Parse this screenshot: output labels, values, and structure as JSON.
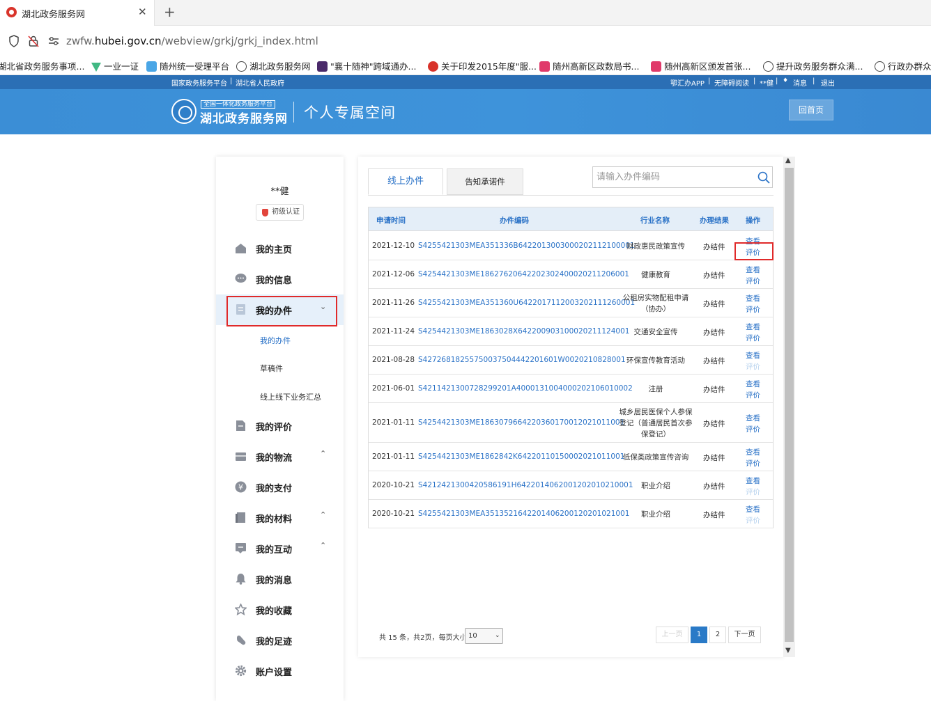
{
  "browser": {
    "tab_title": "湖北政务服务网",
    "tab_close": "✕",
    "new_tab": "+",
    "url_prefix": "zwfw.",
    "url_domain": "hubei.gov.cn",
    "url_path": "/webview/grkj/grkj_index.html",
    "bookmarks": [
      {
        "label": "湖北省政务服务事项...",
        "color": "#ffffff"
      },
      {
        "label": "一业一证",
        "color": "#41b883"
      },
      {
        "label": "随州统一受理平台",
        "color": "#4aa6e6"
      },
      {
        "label": "湖北政务服务网",
        "color": "#ffffff"
      },
      {
        "label": "\"襄十随神\"跨域通办...",
        "color": "#4a2a6a"
      },
      {
        "label": "关于印发2015年度\"服...",
        "color": "#d8322a"
      },
      {
        "label": "随州高新区政数局书...",
        "color": "#e03a6a"
      },
      {
        "label": "随州高新区颁发首张...",
        "color": "#e03a6a"
      },
      {
        "label": "提升政务服务群众满...",
        "color": "#ffffff"
      },
      {
        "label": "行政办群众",
        "color": "#ffffff"
      }
    ]
  },
  "site": {
    "top_left": [
      "国家政务服务平台",
      "|",
      "湖北省人民政府"
    ],
    "top_right": [
      "鄂汇办APP",
      "|",
      "无障碍阅读",
      "|",
      "**健",
      "|",
      "消息",
      "|",
      "退出"
    ],
    "logo_tag": "全国一体化政务服务平台",
    "logo_name": "湖北政务服务网",
    "space_title": "个人专属空间",
    "home_button": "回首页"
  },
  "sidebar": {
    "user_name": "**健",
    "auth_badge": "初级认证",
    "menu": [
      {
        "label": "我的主页",
        "icon": "home-icon",
        "expanded": null
      },
      {
        "label": "我的信息",
        "icon": "chat-icon",
        "expanded": null
      },
      {
        "label": "我的办件",
        "icon": "document-icon",
        "expanded": true
      },
      {
        "label": "我的评价",
        "icon": "evaluation-icon",
        "expanded": null
      },
      {
        "label": "我的物流",
        "icon": "logistics-icon",
        "expanded": false
      },
      {
        "label": "我的支付",
        "icon": "yen-icon",
        "expanded": null
      },
      {
        "label": "我的材料",
        "icon": "materials-icon",
        "expanded": false
      },
      {
        "label": "我的互动",
        "icon": "interaction-icon",
        "expanded": false
      },
      {
        "label": "我的消息",
        "icon": "bell-icon",
        "expanded": null
      },
      {
        "label": "我的收藏",
        "icon": "star-icon",
        "expanded": null
      },
      {
        "label": "我的足迹",
        "icon": "footprint-icon",
        "expanded": null
      },
      {
        "label": "账户设置",
        "icon": "gear-icon",
        "expanded": null
      }
    ],
    "submenu": [
      "我的办件",
      "草稿件",
      "线上线下业务汇总"
    ]
  },
  "main": {
    "tabs": [
      "线上办件",
      "告知承诺件"
    ],
    "search_placeholder": "请输入办件编码",
    "columns": [
      "申请时间",
      "办件编码",
      "行业名称",
      "办理结果",
      "操作"
    ],
    "view_label": "查看",
    "eval_label": "评价",
    "rows": [
      {
        "date": "2021-12-10",
        "code": "S4255421303MEA351336B6422013003000202112100001",
        "industry": "财政惠民政策宣传",
        "result": "办结件",
        "eval_enabled": true
      },
      {
        "date": "2021-12-06",
        "code": "S4254421303ME18627620642202302400020211206001",
        "industry": "健康教育",
        "result": "办结件",
        "eval_enabled": true
      },
      {
        "date": "2021-11-26",
        "code": "S4255421303MEA351360U6422017112003202111260001",
        "industry": "公租房实物配租申请（协办）",
        "result": "办结件",
        "eval_enabled": true
      },
      {
        "date": "2021-11-24",
        "code": "S4254421303ME1863028X642200903100020211124001",
        "industry": "交通安全宣传",
        "result": "办结件",
        "eval_enabled": true
      },
      {
        "date": "2021-08-28",
        "code": "S42726818255750037504442201601W0020210828001",
        "industry": "环保宣传教育活动",
        "result": "办结件",
        "eval_enabled": false
      },
      {
        "date": "2021-06-01",
        "code": "S4211421300728299201A4000131004000202106010002",
        "industry": "注册",
        "result": "办结件",
        "eval_enabled": true
      },
      {
        "date": "2021-01-11",
        "code": "S4254421303ME1863079664220360170012021011001",
        "industry": "城乡居民医保个人参保登记（普通居民首次参保登记）",
        "result": "办结件",
        "eval_enabled": true
      },
      {
        "date": "2021-01-11",
        "code": "S4254421303ME1862842K64220110150002021011001",
        "industry": "低保类政策宣传咨询",
        "result": "办结件",
        "eval_enabled": true
      },
      {
        "date": "2020-10-21",
        "code": "S4212421300420586191H6422014062001202010210001",
        "industry": "职业介绍",
        "result": "办结件",
        "eval_enabled": false
      },
      {
        "date": "2020-10-21",
        "code": "S4255421303MEA3513521642201406200120201021001",
        "industry": "职业介绍",
        "result": "办结件",
        "eval_enabled": false
      }
    ],
    "pagination": {
      "info": "共 15 条，共2页，每页大小",
      "page_size": "10",
      "prev": "上一页",
      "pages": [
        "1",
        "2"
      ],
      "current": "1",
      "next": "下一页"
    }
  }
}
